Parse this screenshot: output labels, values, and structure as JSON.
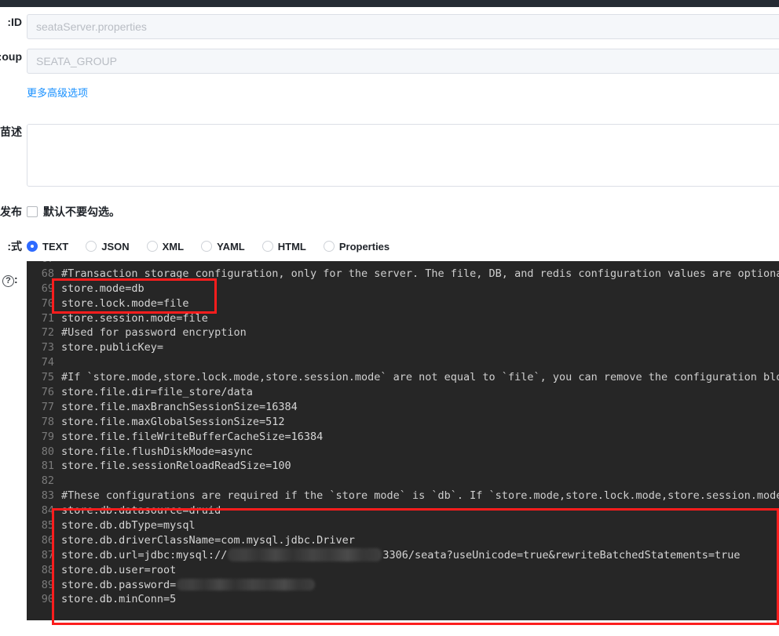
{
  "form": {
    "data_id": {
      "label": "ID:",
      "placeholder": "seataServer.properties",
      "value": ""
    },
    "group": {
      "label": "oup:",
      "placeholder": "SEATA_GROUP",
      "value": ""
    },
    "advanced_link": "更多高级选项",
    "description": {
      "label": "苗述:",
      "value": "",
      "placeholder": ""
    },
    "publish": {
      "label": "发布:",
      "checkbox_label": "默认不要勾选。",
      "checked": false
    },
    "format": {
      "label": "式:",
      "selected": "TEXT",
      "options": [
        "TEXT",
        "JSON",
        "XML",
        "YAML",
        "HTML",
        "Properties"
      ]
    },
    "content": {
      "label": "?):",
      "help_icon": "?"
    }
  },
  "editor": {
    "first_visible_line": 67,
    "lines": [
      {
        "no": "67",
        "text": "",
        "comment": false
      },
      {
        "no": "68",
        "text": "#Transaction storage configuration, only for the server. The file, DB, and redis configuration values are optional",
        "comment": true
      },
      {
        "no": "69",
        "text": "store.mode=db",
        "comment": false
      },
      {
        "no": "70",
        "text": "store.lock.mode=file",
        "comment": false
      },
      {
        "no": "71",
        "text": "store.session.mode=file",
        "comment": false
      },
      {
        "no": "72",
        "text": "#Used for password encryption",
        "comment": true
      },
      {
        "no": "73",
        "text": "store.publicKey=",
        "comment": false
      },
      {
        "no": "74",
        "text": "",
        "comment": false
      },
      {
        "no": "75",
        "text": "#If `store.mode,store.lock.mode,store.session.mode` are not equal to `file`, you can remove the configuration bloc",
        "comment": true
      },
      {
        "no": "76",
        "text": "store.file.dir=file_store/data",
        "comment": false
      },
      {
        "no": "77",
        "text": "store.file.maxBranchSessionSize=16384",
        "comment": false
      },
      {
        "no": "78",
        "text": "store.file.maxGlobalSessionSize=512",
        "comment": false
      },
      {
        "no": "79",
        "text": "store.file.fileWriteBufferCacheSize=16384",
        "comment": false
      },
      {
        "no": "80",
        "text": "store.file.flushDiskMode=async",
        "comment": false
      },
      {
        "no": "81",
        "text": "store.file.sessionReloadReadSize=100",
        "comment": false
      },
      {
        "no": "82",
        "text": "",
        "comment": false
      },
      {
        "no": "83",
        "text": "#These configurations are required if the `store mode` is `db`. If `store.mode,store.lock.mode,store.session.mode`",
        "comment": true
      },
      {
        "no": "84",
        "text": "store.db.datasource=druid",
        "comment": false
      },
      {
        "no": "85",
        "text": "store.db.dbType=mysql",
        "comment": false
      },
      {
        "no": "86",
        "text": "store.db.driverClassName=com.mysql.jdbc.Driver",
        "comment": false
      },
      {
        "no": "88",
        "text": "store.db.user=root",
        "comment": false
      },
      {
        "no": "90",
        "text": "store.db.minConn=5",
        "comment": false
      }
    ],
    "line_87": {
      "no": "87",
      "prefix": "store.db.url=jdbc:mysql://",
      "suffix": "3306/seata?useUnicode=true&rewriteBatchedStatements=true",
      "redacted": true
    },
    "line_89": {
      "no": "89",
      "prefix": "store.db.password=",
      "suffix": "",
      "redacted": true
    }
  },
  "annotations": {
    "box_store_mode": "store.mode=db highlight",
    "box_db_block": "store.db.* configuration block highlight",
    "color": "#fc1d1d"
  }
}
